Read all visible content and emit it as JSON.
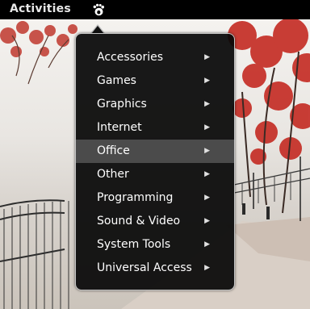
{
  "top_panel": {
    "activities_label": "Activities",
    "apps_button_icon": "gnome-foot-icon"
  },
  "menu": {
    "items": [
      {
        "label": "Accessories",
        "arrow": "▶"
      },
      {
        "label": "Games",
        "arrow": "▶"
      },
      {
        "label": "Graphics",
        "arrow": "▶"
      },
      {
        "label": "Internet",
        "arrow": "▶"
      },
      {
        "label": "Office",
        "arrow": "▶"
      },
      {
        "label": "Other",
        "arrow": "▶"
      },
      {
        "label": "Programming",
        "arrow": "▶"
      },
      {
        "label": "Sound & Video",
        "arrow": "▶"
      },
      {
        "label": "System Tools",
        "arrow": "▶"
      },
      {
        "label": "Universal Access",
        "arrow": "▶"
      }
    ],
    "highlighted_item": "Office"
  },
  "colors": {
    "panel_bg": "#000000",
    "menu_bg": "#080808",
    "menu_border": "#c4c4c4",
    "highlight_bg": "#4b4b4b",
    "text": "#ffffff"
  }
}
